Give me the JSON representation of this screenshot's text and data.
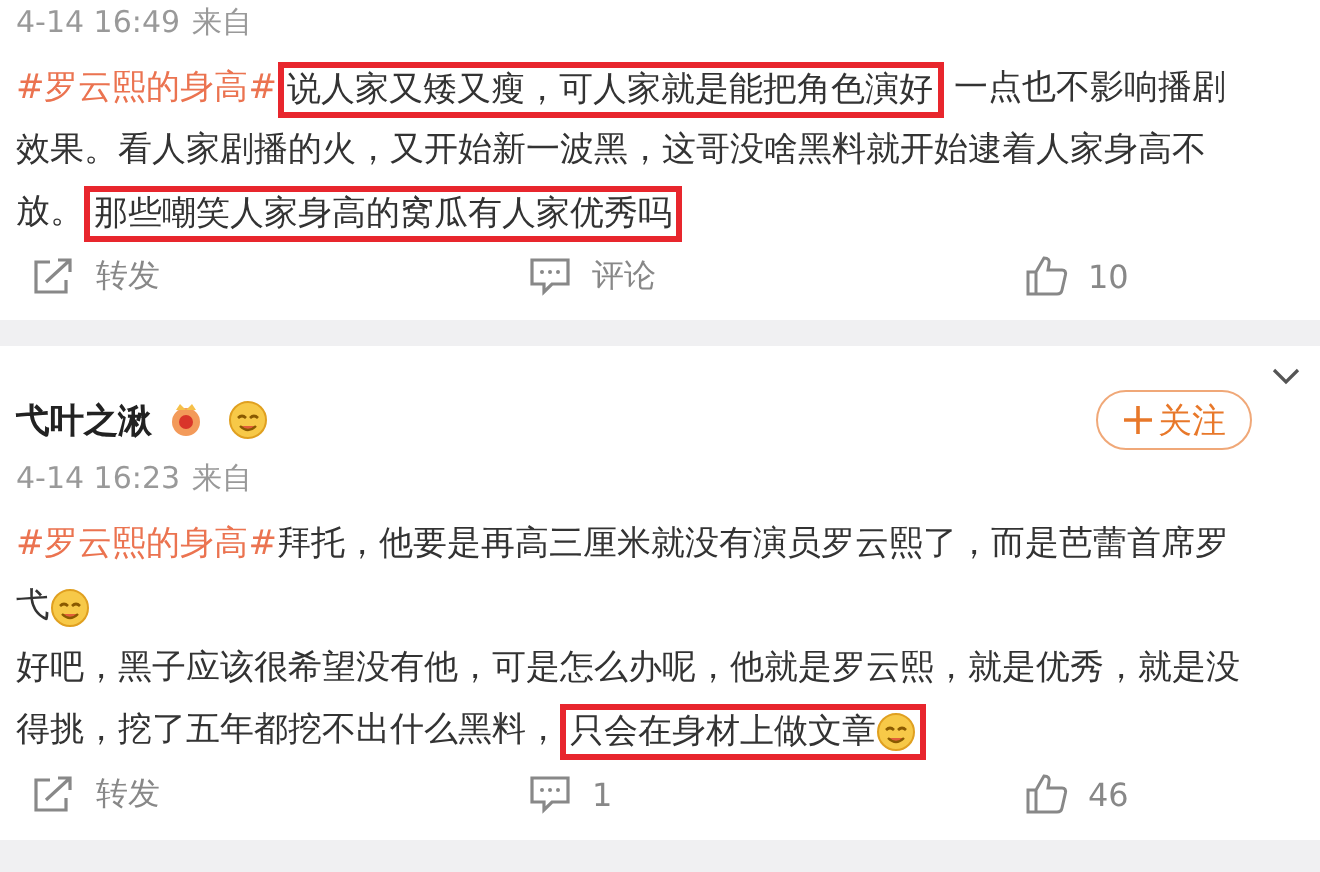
{
  "posts": [
    {
      "time": "4-14 16:49",
      "source_label": "来自",
      "lines": [
        [
          {
            "kind": "hashtag",
            "text": "#罗云熙的身高#",
            "highlighted": false
          },
          {
            "kind": "text",
            "text": "说人家又矮又瘦，可人家就是能把角色演好",
            "highlighted": true
          },
          {
            "kind": "text",
            "text": " 一点也不影响播剧",
            "highlighted": false
          }
        ],
        [
          {
            "kind": "text",
            "text": "效果。看人家剧播的火，又开始新一波黑，这哥没啥黑料就开始逮着人家身高不",
            "highlighted": false
          }
        ],
        [
          {
            "kind": "text",
            "text": "放。",
            "highlighted": false
          },
          {
            "kind": "text",
            "text": "那些嘲笑人家身高的窝瓜有人家优秀吗",
            "highlighted": true
          }
        ]
      ],
      "actions": {
        "repost": "转发",
        "comment": "评论",
        "like": "10"
      }
    },
    {
      "author": {
        "name": "弋叶之湫",
        "follow_label": "关注"
      },
      "time": "4-14 16:23",
      "source_label": "来自",
      "lines": [
        [
          {
            "kind": "hashtag",
            "text": "#罗云熙的身高#",
            "highlighted": false
          },
          {
            "kind": "text",
            "text": "拜托，他要是再高三厘米就没有演员罗云熙了，而是芭蕾首席罗",
            "highlighted": false
          }
        ],
        [
          {
            "kind": "text",
            "text": "弋",
            "highlighted": false
          },
          {
            "kind": "emoji",
            "highlighted": false
          }
        ],
        [
          {
            "kind": "text",
            "text": "好吧，黑子应该很希望没有他，可是怎么办呢，他就是罗云熙，就是优秀，就是没",
            "highlighted": false
          }
        ],
        [
          {
            "kind": "text",
            "text": "得挑，挖了五年都挖不出什么黑料，",
            "highlighted": false
          },
          {
            "kind": "text",
            "text": "只会在身材上做文章",
            "highlighted": true
          },
          {
            "kind": "emoji",
            "highlighted": true
          }
        ]
      ],
      "actions": {
        "repost": "转发",
        "comment": "1",
        "like": "46"
      }
    }
  ]
}
